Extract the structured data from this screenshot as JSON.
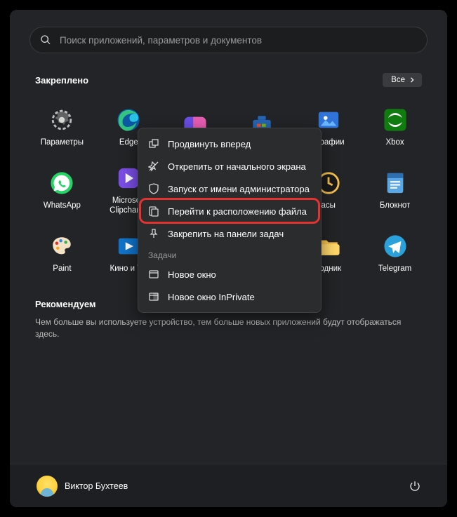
{
  "search": {
    "placeholder": "Поиск приложений, параметров и документов"
  },
  "pinned": {
    "title": "Закреплено",
    "all_button": "Все",
    "apps": [
      {
        "label": "Параметры",
        "icon": "settings"
      },
      {
        "label": "Edge",
        "icon": "edge"
      },
      {
        "label": "",
        "icon": "copilot"
      },
      {
        "label": "",
        "icon": "store"
      },
      {
        "label": "ографии",
        "icon": "photos"
      },
      {
        "label": "Xbox",
        "icon": "xbox"
      },
      {
        "label": "WhatsApp",
        "icon": "whatsapp"
      },
      {
        "label": "Microsoft Clipchamp",
        "icon": "clipchamp"
      },
      {
        "label": "",
        "icon": "hidden"
      },
      {
        "label": "",
        "icon": "hidden"
      },
      {
        "label": "асы",
        "icon": "clock"
      },
      {
        "label": "Блокнот",
        "icon": "notepad"
      },
      {
        "label": "Paint",
        "icon": "paint"
      },
      {
        "label": "Кино и ТВ",
        "icon": "movies"
      },
      {
        "label": "",
        "icon": "hidden"
      },
      {
        "label": "",
        "icon": "hidden"
      },
      {
        "label": "водник",
        "icon": "explorer"
      },
      {
        "label": "Telegram",
        "icon": "telegram"
      }
    ]
  },
  "context_menu": {
    "items": [
      {
        "label": "Продвинуть вперед",
        "icon": "move-front"
      },
      {
        "label": "Открепить от начального экрана",
        "icon": "unpin"
      },
      {
        "label": "Запуск от имени администратора",
        "icon": "admin"
      },
      {
        "label": "Перейти к расположению файла",
        "icon": "file-location",
        "highlighted": true
      },
      {
        "label": "Закрепить на панели задач",
        "icon": "pin-taskbar"
      }
    ],
    "tasks_label": "Задачи",
    "tasks": [
      {
        "label": "Новое окно",
        "icon": "window"
      },
      {
        "label": "Новое окно InPrivate",
        "icon": "inprivate"
      }
    ]
  },
  "recommended": {
    "title": "Рекомендуем",
    "text": "Чем больше вы используете устройство, тем больше новых приложений будут отображаться здесь."
  },
  "footer": {
    "user_name": "Виктор Бухтеев"
  }
}
